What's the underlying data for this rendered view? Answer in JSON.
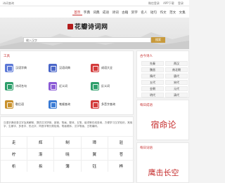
{
  "topbar": {
    "left": "诗词查询",
    "right": [
      "微信登录",
      "APP下载",
      "登录"
    ]
  },
  "nav": {
    "items": [
      "首页",
      "字典",
      "词典",
      "成语",
      "诗词",
      "古籍",
      "赏字",
      "名人",
      "短句",
      "作文",
      "范文",
      "文集"
    ],
    "active": 0
  },
  "logo": {
    "text": "花瓣诗词网"
  },
  "search": {
    "placeholder": "输入汉字",
    "button": "搜索"
  },
  "tools": {
    "title": "工具",
    "items": [
      {
        "label": "汉语字典",
        "color": "#5b78d6"
      },
      {
        "label": "汉语词典",
        "color": "#4a66c8"
      },
      {
        "label": "成语大全",
        "color": "#d33b3b"
      },
      {
        "label": "诗词名句",
        "color": "#2e9f6b"
      },
      {
        "label": "近义词",
        "color": "#8b5bd6"
      },
      {
        "label": "反义词",
        "color": "#2e9f6b"
      },
      {
        "label": "歇后语",
        "color": "#c9912c"
      },
      {
        "label": "笔顺查询",
        "color": "#3a7bd5"
      },
      {
        "label": "多音字查询",
        "color": "#d33b3b"
      }
    ]
  },
  "chars": {
    "desc": "汉语字典收录汉字及其解释，提供汉字拼音、部首、笔画、繁体、五笔、组词等在线查询，方便学习汉字知识。常用字、生僻字、多音字、形近字、同音字等分类检索，笔画顺序、汉字笔画、五笔编码。",
    "rows": [
      [
        "走",
        "辉",
        "制",
        "璋",
        "驻"
      ],
      [
        "柠",
        "渐",
        "晓",
        "翼",
        "苍"
      ],
      [
        "析",
        "拆",
        "薄",
        "钰",
        "桦"
      ]
    ]
  },
  "dynasties": {
    "title": "古今诗人",
    "rows": [
      [
        "先秦",
        "两汉"
      ],
      [
        "魏晋",
        "南北朝"
      ],
      [
        "隋代",
        "唐代"
      ],
      [
        "五代",
        "宋代"
      ],
      [
        "金朝",
        "元代"
      ],
      [
        "明代",
        "清代"
      ]
    ]
  },
  "daily_idiom": {
    "title": "每日成语",
    "word": "宿命论"
  },
  "daily_word": {
    "title": "每日词语",
    "word": "鹰击长空"
  }
}
